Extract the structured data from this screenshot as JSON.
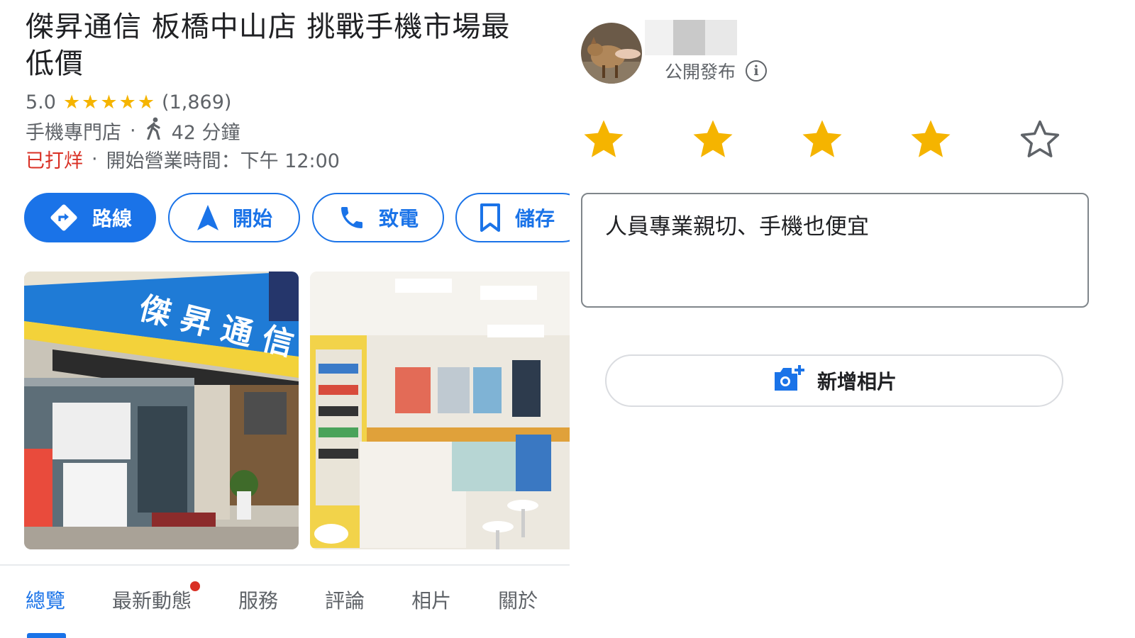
{
  "place": {
    "name": "傑昇通信 板橋中山店 挑戰手機市場最低價",
    "rating": "5.0",
    "review_count": "(1,869)",
    "category": "手機專門店",
    "walk_time": "42 分鐘",
    "status": "已打烊",
    "opening_label": "開始營業時間：下午 12:00"
  },
  "actions": {
    "directions": "路線",
    "start": "開始",
    "call": "致電",
    "save": "儲存"
  },
  "tabs": [
    "總覽",
    "最新動態",
    "服務",
    "評論",
    "相片",
    "關於"
  ],
  "colors": {
    "accent": "#1a73e8",
    "star": "#f5b400",
    "closed": "#d93025"
  },
  "review": {
    "visibility": "公開發布",
    "stars_selected": 4,
    "stars_total": 5,
    "text": "人員專業親切、手機也便宜",
    "add_photo_label": "新增相片"
  }
}
